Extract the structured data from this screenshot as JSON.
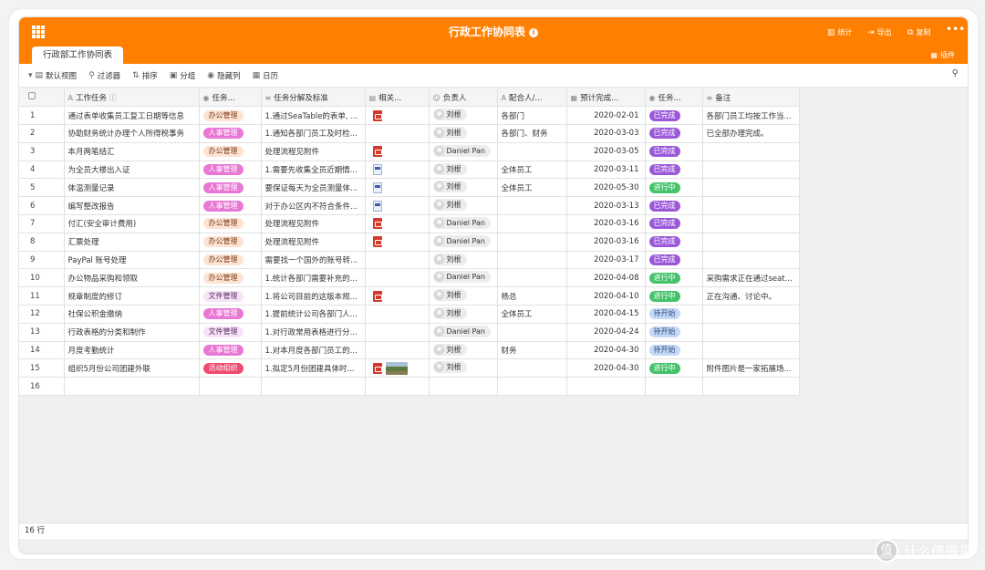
{
  "app": {
    "title": "行政工作协同表",
    "info_icon": "info-icon",
    "toolbar_buttons": [
      {
        "label": "统计",
        "icon": "chart-icon"
      },
      {
        "label": "导出",
        "icon": "export-icon"
      },
      {
        "label": "复制",
        "icon": "copy-icon"
      }
    ],
    "more_icon": "more-icon",
    "tab_label": "行政部工作协同表",
    "plugin_label": "插件",
    "accent_color": "#ff8000"
  },
  "toolbar": {
    "view_label": "默认视图",
    "filter_label": "过滤器",
    "sort_label": "排序",
    "group_label": "分组",
    "hide_label": "隐藏列",
    "calendar_label": "日历"
  },
  "columns": [
    "工作任务",
    "任务...",
    "任务分解及标准",
    "相关...",
    "负责人",
    "配合人/...",
    "预计完成...",
    "任务...",
    "备注"
  ],
  "rows": [
    {
      "num": "1",
      "task": "通过表单收集员工复工日期等信息",
      "cat": "办公管理",
      "breakdown": "1.通过SeaTable的表单, ...",
      "files": "pdf",
      "owner": "刘根",
      "partner": "各部门",
      "date": "2020-02-01",
      "status": "已完成",
      "note": "各部门员工均按工作当..."
    },
    {
      "num": "2",
      "task": "协助财务统计办理个人所得税事务",
      "cat": "人事管理",
      "breakdown": "1.通知各部门员工及时检...",
      "files": "",
      "owner": "刘根",
      "partner": "各部门、财务",
      "date": "2020-03-03",
      "status": "已完成",
      "note": "已全部办理完成。"
    },
    {
      "num": "3",
      "task": "本月两笔结汇",
      "cat": "办公管理",
      "breakdown": "处理流程见附件",
      "files": "pdf",
      "owner": "Daniel Pan",
      "partner": "",
      "date": "2020-03-05",
      "status": "已完成",
      "note": ""
    },
    {
      "num": "4",
      "task": "为全员大楼出入证",
      "cat": "人事管理",
      "breakdown": "1.需要先收集全员近期情...",
      "files": "doc",
      "owner": "刘根",
      "partner": "全体员工",
      "date": "2020-03-11",
      "status": "已完成",
      "note": ""
    },
    {
      "num": "5",
      "task": "体温测量记录",
      "cat": "人事管理",
      "breakdown": "要保证每天为全员测量体...",
      "files": "doc",
      "owner": "刘根",
      "partner": "全体员工",
      "date": "2020-05-30",
      "status": "进行中",
      "note": ""
    },
    {
      "num": "6",
      "task": "编写整改报告",
      "cat": "人事管理",
      "breakdown": "对于办公区内不符合条件...",
      "files": "doc",
      "owner": "刘根",
      "partner": "",
      "date": "2020-03-13",
      "status": "已完成",
      "note": ""
    },
    {
      "num": "7",
      "task": "付汇(安全审计费用)",
      "cat": "办公管理",
      "breakdown": "处理流程见附件",
      "files": "pdf",
      "owner": "Daniel Pan",
      "partner": "",
      "date": "2020-03-16",
      "status": "已完成",
      "note": ""
    },
    {
      "num": "8",
      "task": "汇票处理",
      "cat": "办公管理",
      "breakdown": "处理流程见附件",
      "files": "pdf",
      "owner": "Daniel Pan",
      "partner": "",
      "date": "2020-03-16",
      "status": "已完成",
      "note": ""
    },
    {
      "num": "9",
      "task": "PayPal 账号处理",
      "cat": "办公管理",
      "breakdown": "需要找一个国外的账号转...",
      "files": "",
      "owner": "刘根",
      "partner": "",
      "date": "2020-03-17",
      "status": "已完成",
      "note": ""
    },
    {
      "num": "10",
      "task": "办公物品采购和领取",
      "cat": "办公管理",
      "breakdown": "1.统计各部门需要补充的...",
      "files": "",
      "owner": "Daniel Pan",
      "partner": "",
      "date": "2020-04-08",
      "status": "进行中",
      "note": "采购需求正在通过seat..."
    },
    {
      "num": "11",
      "task": "规章制度的修订",
      "cat": "文件管理",
      "breakdown": "1.将公司目前的这版本规...",
      "files": "pdf",
      "owner": "刘根",
      "partner": "杨总",
      "date": "2020-04-10",
      "status": "进行中",
      "note": "正在沟通、讨论中。"
    },
    {
      "num": "12",
      "task": "社保公积金缴纳",
      "cat": "人事管理",
      "breakdown": "1.提前统计公司各部门人...",
      "files": "",
      "owner": "刘根",
      "partner": "全体员工",
      "date": "2020-04-15",
      "status": "待开始",
      "note": ""
    },
    {
      "num": "13",
      "task": "行政表格的分类和制作",
      "cat": "文件管理",
      "breakdown": "1.对行政常用表格进行分...",
      "files": "",
      "owner": "Daniel Pan",
      "partner": "",
      "date": "2020-04-24",
      "status": "待开始",
      "note": ""
    },
    {
      "num": "14",
      "task": "月度考勤统计",
      "cat": "人事管理",
      "breakdown": "1.对本月度各部门员工的...",
      "files": "",
      "owner": "刘根",
      "partner": "财务",
      "date": "2020-04-30",
      "status": "待开始",
      "note": ""
    },
    {
      "num": "15",
      "task": "组织5月份公司团建外联",
      "cat": "活动组织",
      "breakdown": "1.拟定5月份团建具体时...",
      "files": "pdf-img",
      "owner": "刘根",
      "partner": "",
      "date": "2020-04-30",
      "status": "进行中",
      "note": "附件图片是一家拓展场..."
    }
  ],
  "empty_row_num": "16",
  "footer": {
    "row_count": "16 行"
  },
  "category_colors": {
    "办公管理": {
      "bg": "#fde3d3",
      "fg": "#7a3a14"
    },
    "人事管理": {
      "bg": "#e878d4",
      "fg": "#ffffff"
    },
    "文件管理": {
      "bg": "#f6e3f7",
      "fg": "#5b2d60"
    },
    "活动组织": {
      "bg": "#f04a6e",
      "fg": "#ffffff"
    }
  },
  "status_colors": {
    "已完成": {
      "bg": "#9b59d9",
      "fg": "#ffffff"
    },
    "进行中": {
      "bg": "#44c46a",
      "fg": "#ffffff"
    },
    "待开始": {
      "bg": "#c4d8f7",
      "fg": "#2f4d7a"
    }
  },
  "watermark": {
    "text": "什么值得买",
    "icon_glyph": "值"
  }
}
